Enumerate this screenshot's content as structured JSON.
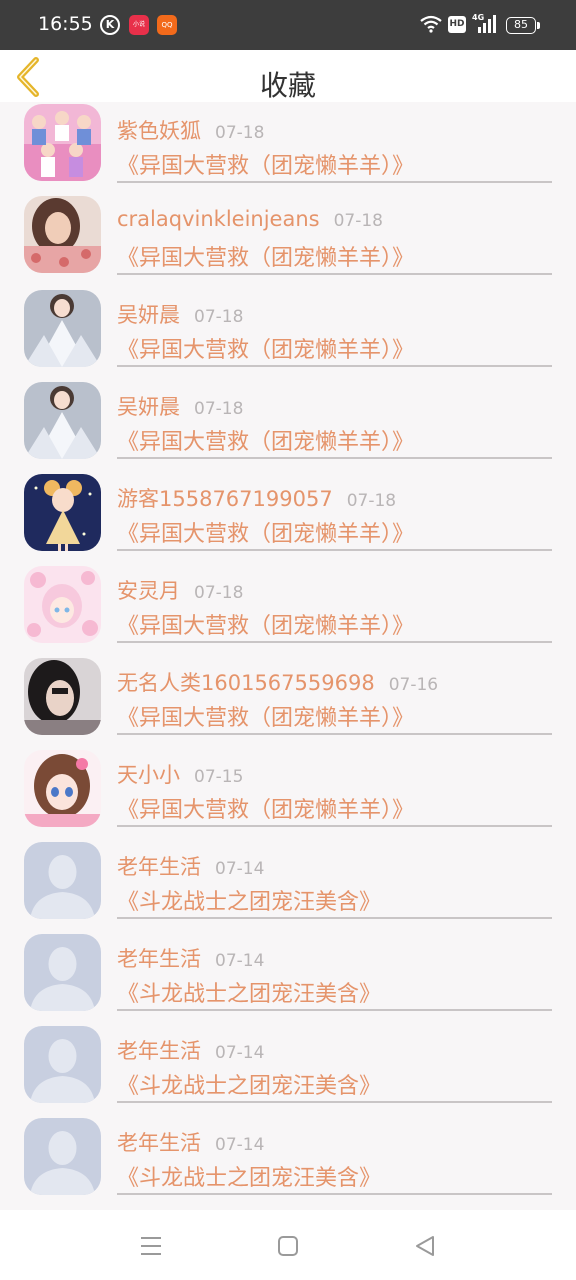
{
  "status_bar": {
    "time": "16:55",
    "k_label": "K",
    "app1_label": "小说",
    "app2_label": "QQ",
    "network": "4G",
    "hd": "HD",
    "battery": "85"
  },
  "header": {
    "title": "收藏",
    "back_icon": "chevron-left-icon",
    "accent_color": "#e5b52a"
  },
  "colors": {
    "name": "#e5946b",
    "date": "#b9b5b6",
    "background": "#f8f6f7"
  },
  "favorites": [
    {
      "name": "紫色妖狐",
      "date": "07-18",
      "book": "《异国大营救（团宠懒羊羊）》",
      "avatar": "pink-group-avatar"
    },
    {
      "name": "cralaqvinkleinjeans",
      "date": "07-18",
      "book": "《异国大营救（团宠懒羊羊）》",
      "avatar": "girl-photo-avatar"
    },
    {
      "name": "吴妍晨",
      "date": "07-18",
      "book": "《异国大营救（团宠懒羊羊）》",
      "avatar": "bride-avatar"
    },
    {
      "name": "吴妍晨",
      "date": "07-18",
      "book": "《异国大营救（团宠懒羊羊）》",
      "avatar": "bride-avatar"
    },
    {
      "name": "游客1558767199057",
      "date": "07-18",
      "book": "《异国大营救（团宠懒羊羊）》",
      "avatar": "doll-avatar"
    },
    {
      "name": "安灵月",
      "date": "07-18",
      "book": "《异国大营救（团宠懒羊羊）》",
      "avatar": "anime-pink-avatar"
    },
    {
      "name": "无名人类1601567559698",
      "date": "07-16",
      "book": "《异国大营救（团宠懒羊羊）》",
      "avatar": "dark-hair-photo-avatar"
    },
    {
      "name": "天小小",
      "date": "07-15",
      "book": "《异国大营救（团宠懒羊羊）》",
      "avatar": "anime-girl-avatar"
    },
    {
      "name": "老年生活",
      "date": "07-14",
      "book": "《斗龙战士之团宠汪美含》",
      "avatar": "default-user-avatar"
    },
    {
      "name": "老年生活",
      "date": "07-14",
      "book": "《斗龙战士之团宠汪美含》",
      "avatar": "default-user-avatar"
    },
    {
      "name": "老年生活",
      "date": "07-14",
      "book": "《斗龙战士之团宠汪美含》",
      "avatar": "default-user-avatar"
    },
    {
      "name": "老年生活",
      "date": "07-14",
      "book": "《斗龙战士之团宠汪美含》",
      "avatar": "default-user-avatar"
    }
  ],
  "nav_bar": {
    "menu_icon": "menu-icon",
    "home_icon": "home-square-icon",
    "back_icon": "back-triangle-icon"
  }
}
